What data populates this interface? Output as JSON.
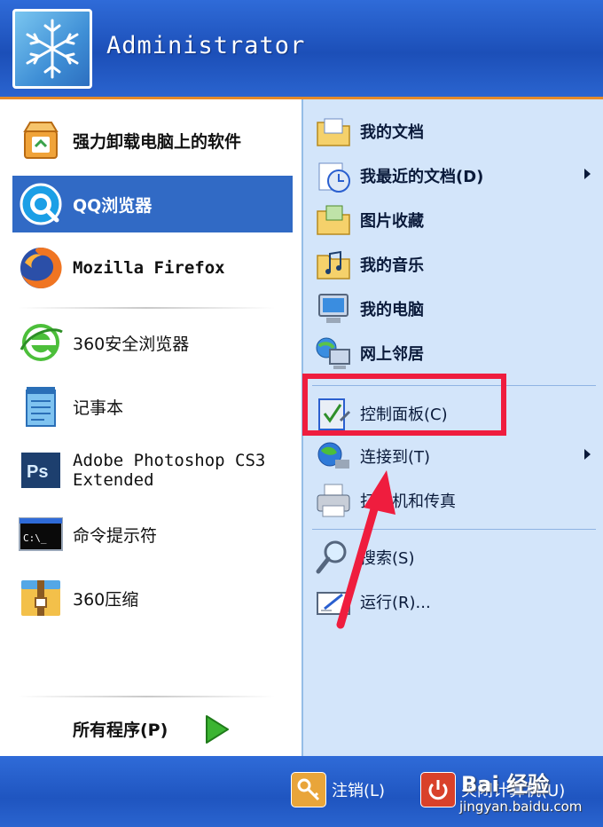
{
  "header": {
    "username": "Administrator"
  },
  "left": {
    "items": [
      {
        "label": "强力卸载电脑上的软件",
        "bold": true
      },
      {
        "label": "QQ浏览器",
        "selected": true
      },
      {
        "label": "Mozilla Firefox"
      },
      {
        "label": "360安全浏览器"
      },
      {
        "label": "记事本"
      },
      {
        "label_line1": "Adobe Photoshop CS3",
        "label_line2": "Extended"
      },
      {
        "label": "命令提示符"
      },
      {
        "label": "360压缩"
      }
    ],
    "all_programs": "所有程序(P)"
  },
  "right": {
    "items": [
      {
        "label": "我的文档"
      },
      {
        "label": "我最近的文档(D)"
      },
      {
        "label": "图片收藏"
      },
      {
        "label": "我的音乐"
      },
      {
        "label": "我的电脑"
      },
      {
        "label": "网上邻居"
      },
      {
        "label": "控制面板(C)"
      },
      {
        "label": "连接到(T)"
      },
      {
        "label": "打印机和传真"
      },
      {
        "label": "搜索(S)"
      },
      {
        "label": "运行(R)..."
      }
    ]
  },
  "footer": {
    "logoff": "注销(L)",
    "shutdown": "关闭计算机(U)"
  },
  "watermark": {
    "logo": "Bai 经验",
    "url": "jingyan.baidu.com"
  },
  "colors": {
    "highlight": "#ef1d3e",
    "header_blue": "#1c4fb8",
    "right_pane": "#d3e5fa",
    "selected": "#316ac5"
  }
}
